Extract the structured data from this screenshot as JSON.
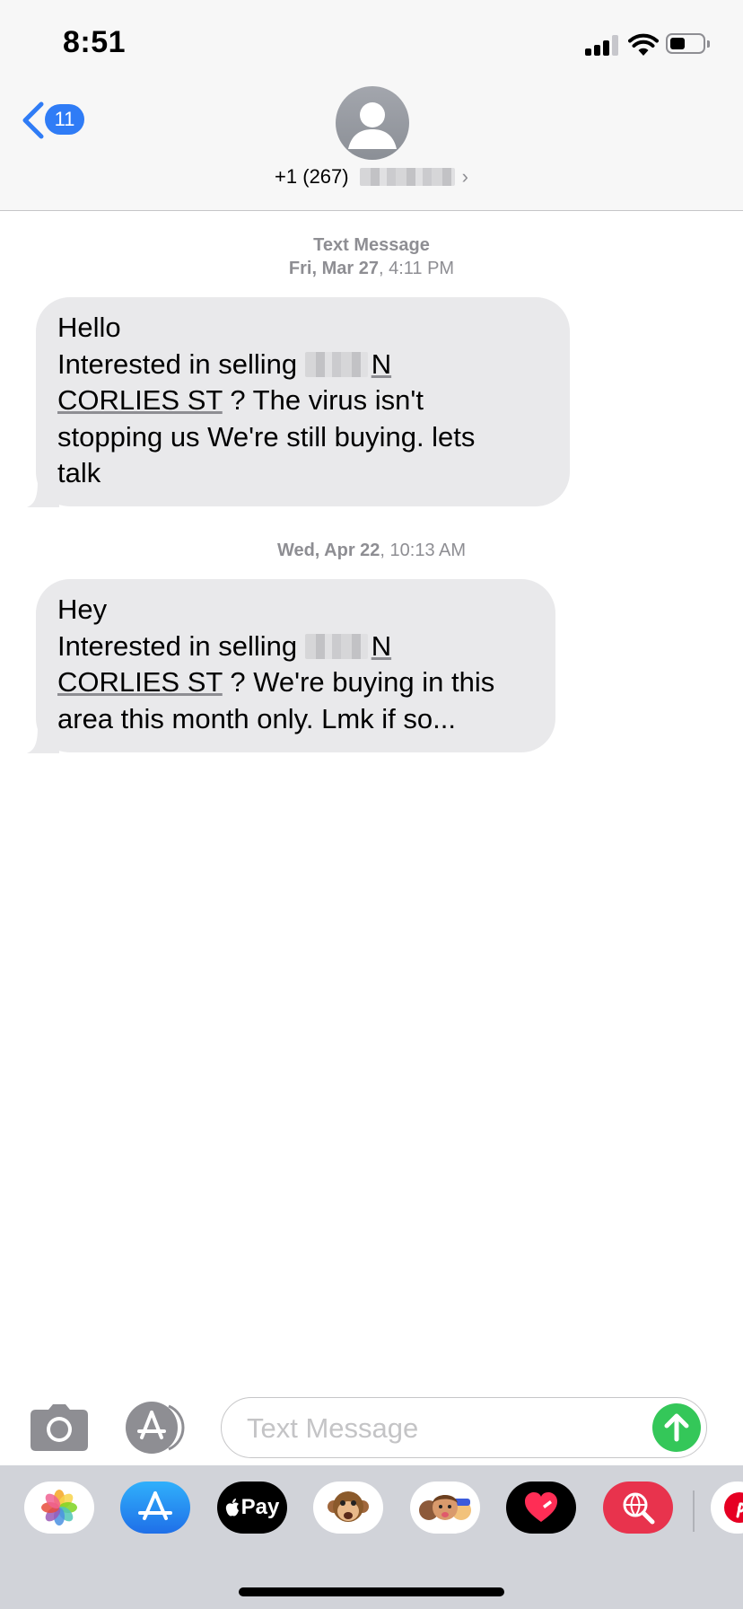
{
  "status_bar": {
    "time": "8:51",
    "signal_icon": "cellular-signal-icon",
    "wifi_icon": "wifi-icon",
    "battery_icon": "battery-icon",
    "battery_level": 0.45
  },
  "header": {
    "back_badge": "11",
    "back_icon": "chevron-left-icon",
    "avatar_icon": "person-icon",
    "contact_number": "+1 (267)",
    "contact_chevron": "›",
    "accent_color": "#2f7cf6"
  },
  "messages": {
    "groups": [
      {
        "label": "Text Message",
        "date_bold": "Fri, Mar 27",
        "time": ", 4:11 PM",
        "bubble": {
          "greeting": "Hello",
          "line_prefix": "Interested in selling ",
          "address_n": "N",
          "address_street": "CORLIES ST",
          "rest_a": " ? The virus isn't",
          "rest_b": "stopping us  We're still buying.  lets",
          "rest_c": "talk"
        }
      },
      {
        "date_bold": "Wed, Apr 22",
        "time": ", 10:13 AM",
        "bubble": {
          "greeting": "Hey",
          "line_prefix": "Interested in selling ",
          "address_n": "N",
          "address_street": "CORLIES ST",
          "rest_a": " ? We're buying in this",
          "rest_b": "area this month only.  Lmk if so..."
        }
      }
    ],
    "bubble_color": "#e9e9eb"
  },
  "compose": {
    "placeholder": "Text Message",
    "camera_icon": "camera-icon",
    "apps_icon": "app-store-icon",
    "send_icon": "arrow-up-icon",
    "send_color": "#34c759"
  },
  "app_drawer": {
    "apps": [
      {
        "name": "photos-app-icon"
      },
      {
        "name": "app-store-app-icon"
      },
      {
        "name": "apple-pay-app-icon",
        "label": "Pay"
      },
      {
        "name": "animoji-app-icon"
      },
      {
        "name": "memoji-stickers-app-icon"
      },
      {
        "name": "digital-touch-app-icon"
      },
      {
        "name": "images-search-app-icon"
      },
      {
        "name": "pinterest-app-icon"
      }
    ]
  }
}
